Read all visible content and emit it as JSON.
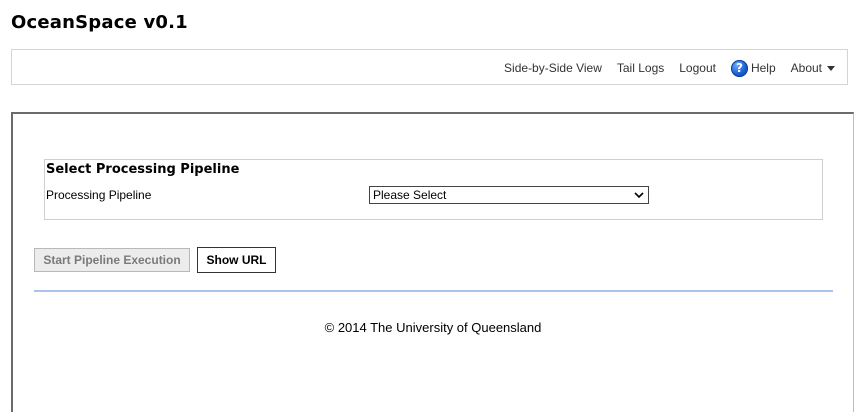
{
  "app": {
    "title": "OceanSpace v0.1"
  },
  "nav": {
    "side_by_side": "Side-by-Side View",
    "tail_logs": "Tail Logs",
    "logout": "Logout",
    "help": "Help",
    "help_icon_glyph": "?",
    "about": "About"
  },
  "pipeline": {
    "section_title": "Select Processing Pipeline",
    "field_label": "Processing Pipeline",
    "selected_value": "Please Select"
  },
  "buttons": {
    "start": "Start Pipeline Execution",
    "show_url": "Show URL"
  },
  "footer": {
    "text": "© 2014 The University of Queensland"
  },
  "colors": {
    "divider": "#a9c3ea",
    "help_icon": "#1a5fd1",
    "disabled_button_bg": "#ececec"
  },
  "icons": {
    "help": "help-circle-icon",
    "about_caret": "caret-down-icon",
    "select_chevron": "chevron-down-icon"
  }
}
